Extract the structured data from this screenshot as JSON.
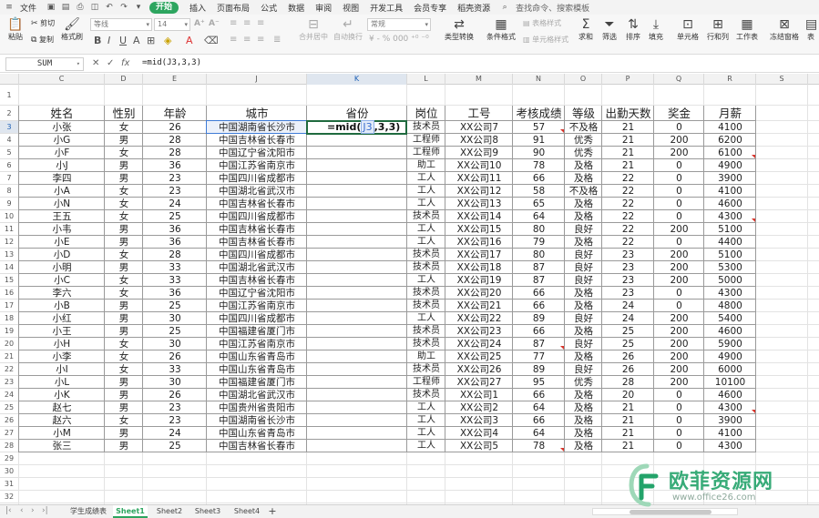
{
  "menu": {
    "file": "文件",
    "tabs": [
      "开始",
      "插入",
      "页面布局",
      "公式",
      "数据",
      "审阅",
      "视图",
      "开发工具",
      "会员专享",
      "稻壳资源"
    ],
    "search": "查找命令、搜索模板"
  },
  "ribbon": {
    "paste": "粘贴",
    "cut": "剪切",
    "copy": "复制",
    "format_painter": "格式刷",
    "font_name": "等线",
    "font_size": "14",
    "merge": "合并居中",
    "wrap": "自动换行",
    "number_format": "常规",
    "type_convert": "类型转换",
    "conditional_format": "条件格式",
    "table_style": "表格样式",
    "cell_style": "单元格样式",
    "sum": "求和",
    "filter": "筛选",
    "sort": "排序",
    "fill": "填充",
    "cell": "单元格",
    "row_col": "行和列",
    "worksheet": "工作表",
    "freeze": "冻结窗格",
    "more": "表"
  },
  "formula_bar": {
    "name_box": "SUM",
    "formula": "=mid(J3,3,3)"
  },
  "columns": [
    "C",
    "D",
    "E",
    "J",
    "K",
    "L",
    "M",
    "N",
    "O",
    "P",
    "Q",
    "R",
    "S"
  ],
  "row_numbers": [
    "1",
    "2",
    "3",
    "4",
    "5",
    "6",
    "7",
    "8",
    "9",
    "10",
    "11",
    "12",
    "13",
    "14",
    "15",
    "16",
    "17",
    "18",
    "19",
    "20",
    "21",
    "22",
    "23",
    "24",
    "25",
    "26",
    "27",
    "28",
    "29",
    "30",
    "31",
    "32"
  ],
  "headers": [
    "姓名",
    "性别",
    "年龄",
    "城市",
    "省份",
    "岗位",
    "工号",
    "考核成绩",
    "等级",
    "出勤天数",
    "奖金",
    "月薪"
  ],
  "editing_cell": {
    "prefix": "=mid(",
    "ref": "J3",
    "suffix": ",3,3)"
  },
  "rows": [
    [
      "小张",
      "女",
      "26",
      "中国湖南省长沙市",
      "",
      "技术员",
      "XX公司7",
      "57",
      "不及格",
      "21",
      "0",
      "4100"
    ],
    [
      "小G",
      "男",
      "28",
      "中国吉林省长春市",
      "",
      "工程师",
      "XX公司8",
      "91",
      "优秀",
      "21",
      "200",
      "6200"
    ],
    [
      "小F",
      "女",
      "28",
      "中国辽宁省沈阳市",
      "",
      "工程师",
      "XX公司9",
      "90",
      "优秀",
      "21",
      "200",
      "6100"
    ],
    [
      "小J",
      "男",
      "36",
      "中国江苏省南京市",
      "",
      "助工",
      "XX公司10",
      "78",
      "及格",
      "21",
      "0",
      "4900"
    ],
    [
      "李四",
      "男",
      "23",
      "中国四川省成都市",
      "",
      "工人",
      "XX公司11",
      "66",
      "及格",
      "22",
      "0",
      "3900"
    ],
    [
      "小A",
      "女",
      "23",
      "中国湖北省武汉市",
      "",
      "工人",
      "XX公司12",
      "58",
      "不及格",
      "22",
      "0",
      "4100"
    ],
    [
      "小N",
      "女",
      "24",
      "中国吉林省长春市",
      "",
      "工人",
      "XX公司13",
      "65",
      "及格",
      "22",
      "0",
      "4600"
    ],
    [
      "王五",
      "女",
      "25",
      "中国四川省成都市",
      "",
      "技术员",
      "XX公司14",
      "64",
      "及格",
      "22",
      "0",
      "4300"
    ],
    [
      "小韦",
      "男",
      "36",
      "中国吉林省长春市",
      "",
      "工人",
      "XX公司15",
      "80",
      "良好",
      "22",
      "200",
      "5100"
    ],
    [
      "小E",
      "男",
      "36",
      "中国吉林省长春市",
      "",
      "工人",
      "XX公司16",
      "79",
      "及格",
      "22",
      "0",
      "4400"
    ],
    [
      "小D",
      "女",
      "28",
      "中国四川省成都市",
      "",
      "技术员",
      "XX公司17",
      "80",
      "良好",
      "23",
      "200",
      "5100"
    ],
    [
      "小明",
      "男",
      "33",
      "中国湖北省武汉市",
      "",
      "技术员",
      "XX公司18",
      "87",
      "良好",
      "23",
      "200",
      "5300"
    ],
    [
      "小C",
      "女",
      "33",
      "中国吉林省长春市",
      "",
      "工人",
      "XX公司19",
      "87",
      "良好",
      "23",
      "200",
      "5000"
    ],
    [
      "李六",
      "女",
      "36",
      "中国辽宁省沈阳市",
      "",
      "技术员",
      "XX公司20",
      "66",
      "及格",
      "23",
      "0",
      "4300"
    ],
    [
      "小B",
      "男",
      "25",
      "中国江苏省南京市",
      "",
      "技术员",
      "XX公司21",
      "66",
      "及格",
      "24",
      "0",
      "4800"
    ],
    [
      "小红",
      "男",
      "30",
      "中国四川省成都市",
      "",
      "工人",
      "XX公司22",
      "89",
      "良好",
      "24",
      "200",
      "5400"
    ],
    [
      "小王",
      "男",
      "25",
      "中国福建省厦门市",
      "",
      "技术员",
      "XX公司23",
      "66",
      "及格",
      "25",
      "200",
      "4600"
    ],
    [
      "小H",
      "女",
      "30",
      "中国江苏省南京市",
      "",
      "技术员",
      "XX公司24",
      "87",
      "良好",
      "25",
      "200",
      "5900"
    ],
    [
      "小李",
      "女",
      "26",
      "中国山东省青岛市",
      "",
      "助工",
      "XX公司25",
      "77",
      "及格",
      "26",
      "200",
      "4900"
    ],
    [
      "小I",
      "女",
      "33",
      "中国山东省青岛市",
      "",
      "技术员",
      "XX公司26",
      "89",
      "良好",
      "26",
      "200",
      "6000"
    ],
    [
      "小L",
      "男",
      "30",
      "中国福建省厦门市",
      "",
      "工程师",
      "XX公司27",
      "95",
      "优秀",
      "28",
      "200",
      "10100"
    ],
    [
      "小K",
      "男",
      "26",
      "中国湖北省武汉市",
      "",
      "技术员",
      "XX公司1",
      "66",
      "及格",
      "20",
      "0",
      "4600"
    ],
    [
      "赵七",
      "男",
      "23",
      "中国贵州省贵阳市",
      "",
      "工人",
      "XX公司2",
      "64",
      "及格",
      "21",
      "0",
      "4300"
    ],
    [
      "赵六",
      "女",
      "23",
      "中国湖南省长沙市",
      "",
      "工人",
      "XX公司3",
      "66",
      "及格",
      "21",
      "0",
      "3900"
    ],
    [
      "小M",
      "男",
      "24",
      "中国山东省青岛市",
      "",
      "工人",
      "XX公司4",
      "64",
      "及格",
      "21",
      "0",
      "4100"
    ],
    [
      "张三",
      "男",
      "25",
      "中国吉林省长春市",
      "",
      "工人",
      "XX公司5",
      "78",
      "及格",
      "21",
      "0",
      "4300"
    ]
  ],
  "sheet_tabs": [
    "学生成绩表",
    "Sheet1",
    "Sheet2",
    "Sheet3",
    "Sheet4"
  ],
  "active_sheet": "Sheet1",
  "add_sheet": "+",
  "watermark": {
    "title": "欧菲资源网",
    "url": "www.office26.com"
  }
}
